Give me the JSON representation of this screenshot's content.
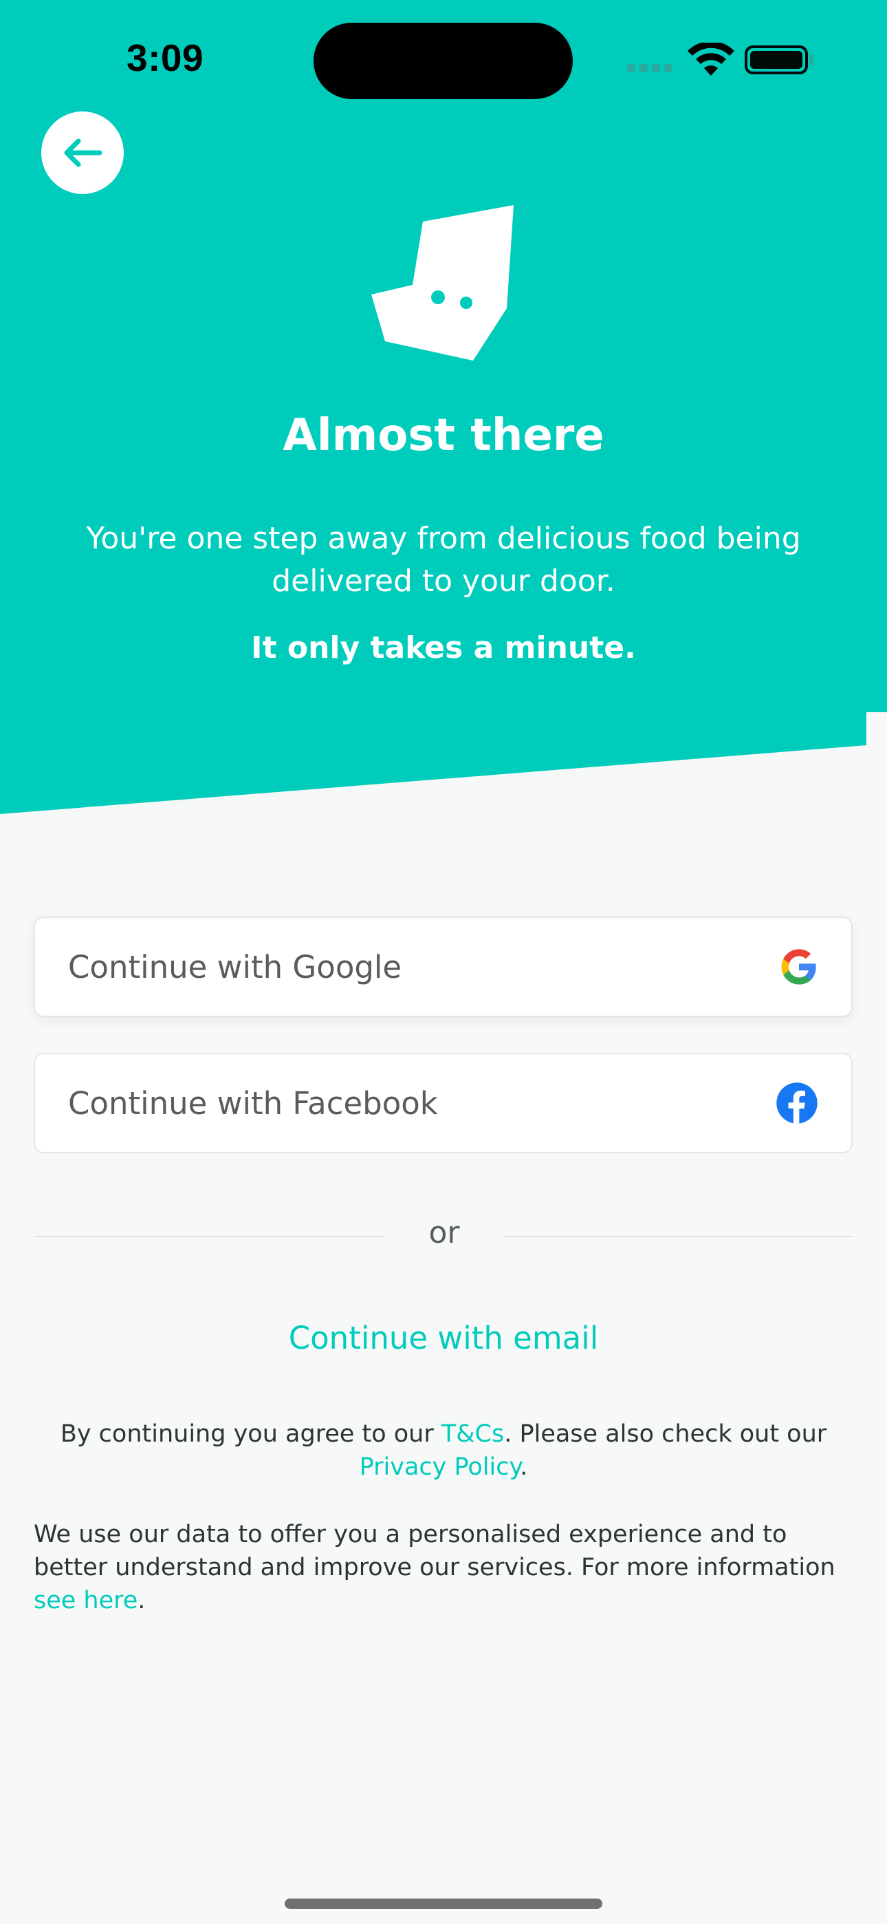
{
  "status_bar": {
    "time": "3:09"
  },
  "header": {
    "back_icon": "arrow-left-icon",
    "logo_icon": "deliveroo-kangaroo-logo",
    "title": "Almost there",
    "subtitle": "You're one step away from delicious food being delivered to your door.",
    "subtitle_strong": "It only takes a minute."
  },
  "auth": {
    "google_label": "Continue with Google",
    "google_icon": "google-icon",
    "facebook_label": "Continue with Facebook",
    "facebook_icon": "facebook-icon",
    "or_label": "or",
    "email_label": "Continue with email"
  },
  "legal": {
    "terms_prefix": "By continuing you agree to our ",
    "terms_link": "T&Cs",
    "terms_middle": ". Please also check out our ",
    "privacy_link": "Privacy Policy",
    "terms_suffix": ".",
    "data_text": "We use our data to offer you a personalised experience and to better understand and improve our services. For more information ",
    "data_link": "see here",
    "data_suffix": "."
  },
  "colors": {
    "brand_teal": "#00ccbc",
    "background": "#f7f8f8",
    "text_dark": "#2e3333",
    "text_button": "#585c5c",
    "facebook_blue": "#1877f2"
  }
}
